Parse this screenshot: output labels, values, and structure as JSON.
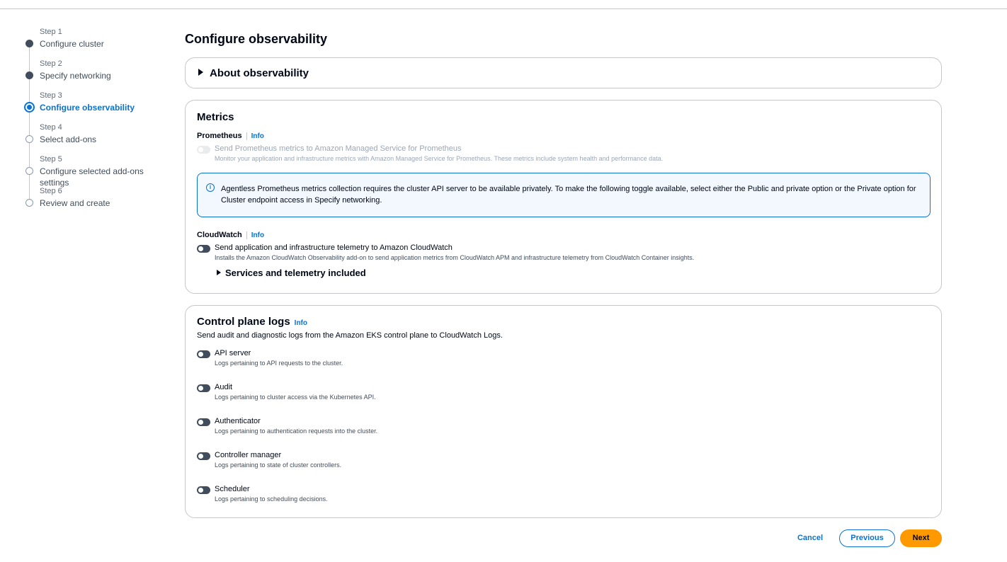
{
  "steps": [
    {
      "num": "Step 1",
      "title": "Configure cluster",
      "state": "done"
    },
    {
      "num": "Step 2",
      "title": "Specify networking",
      "state": "done"
    },
    {
      "num": "Step 3",
      "title": "Configure observability",
      "state": "active"
    },
    {
      "num": "Step 4",
      "title": "Select add-ons",
      "state": "todo"
    },
    {
      "num": "Step 5",
      "title": "Configure selected add-ons settings",
      "state": "todo"
    },
    {
      "num": "Step 6",
      "title": "Review and create",
      "state": "todo"
    }
  ],
  "page_title": "Configure observability",
  "about": {
    "title": "About observability"
  },
  "metrics": {
    "title": "Metrics",
    "prometheus": {
      "label": "Prometheus",
      "info": "Info",
      "toggle_label": "Send Prometheus metrics to Amazon Managed Service for Prometheus",
      "toggle_desc": "Monitor your application and infrastructure metrics with Amazon Managed Service for Prometheus. These metrics include system health and performance data.",
      "enabled": false,
      "disabled": true
    },
    "alert": {
      "icon": "info-icon",
      "text": "Agentless Prometheus metrics collection requires the cluster API server to be available privately. To make the following toggle available, select either the Public and private option or the Private option for Cluster endpoint access in Specify networking."
    },
    "cloudwatch": {
      "label": "CloudWatch",
      "info": "Info",
      "toggle_label": "Send application and infrastructure telemetry to Amazon CloudWatch",
      "toggle_desc": "Installs the Amazon CloudWatch Observability add-on to send application metrics from CloudWatch APM and infrastructure telemetry from CloudWatch Container insights.",
      "enabled": false
    },
    "services_expander": "Services and telemetry included"
  },
  "logs": {
    "title": "Control plane logs",
    "info": "Info",
    "description": "Send audit and diagnostic logs from the Amazon EKS control plane to CloudWatch Logs.",
    "items": [
      {
        "label": "API server",
        "desc": "Logs pertaining to API requests to the cluster.",
        "enabled": false
      },
      {
        "label": "Audit",
        "desc": "Logs pertaining to cluster access via the Kubernetes API.",
        "enabled": false
      },
      {
        "label": "Authenticator",
        "desc": "Logs pertaining to authentication requests into the cluster.",
        "enabled": false
      },
      {
        "label": "Controller manager",
        "desc": "Logs pertaining to state of cluster controllers.",
        "enabled": false
      },
      {
        "label": "Scheduler",
        "desc": "Logs pertaining to scheduling decisions.",
        "enabled": false
      }
    ]
  },
  "footer": {
    "cancel": "Cancel",
    "previous": "Previous",
    "next": "Next"
  },
  "colors": {
    "accent": "#0972d3",
    "primary_button": "#ff9900",
    "toggle_off": "#414d5c"
  }
}
